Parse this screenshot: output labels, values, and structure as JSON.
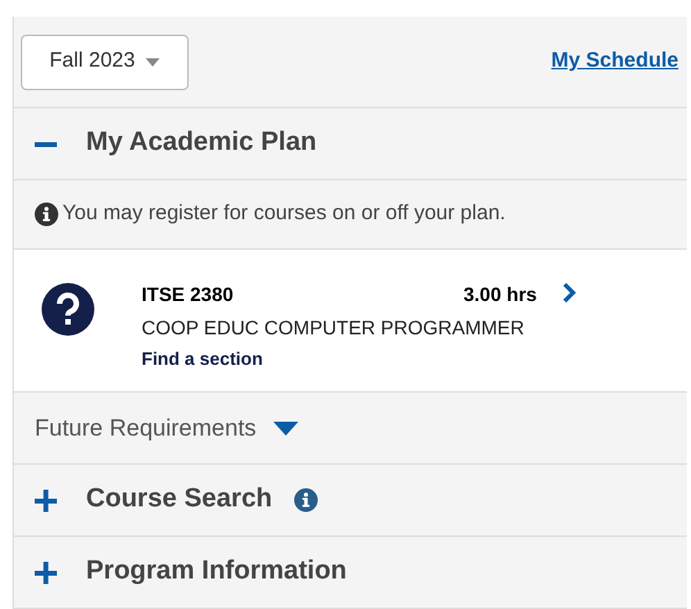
{
  "term_select": {
    "value": "Fall 2023"
  },
  "schedule_link": "My Schedule",
  "academic_plan": {
    "title": "My Academic Plan",
    "expanded": true,
    "notice": "You may register for courses on or off your plan.",
    "courses": [
      {
        "code": "ITSE 2380",
        "hours": "3.00 hrs",
        "title": "COOP EDUC COMPUTER PROGRAMMER",
        "action": "Find a section"
      }
    ],
    "future_requirements": {
      "label": "Future Requirements",
      "expanded": false
    }
  },
  "sections": [
    {
      "title": "Course Search",
      "expanded": false,
      "info": true
    },
    {
      "title": "Program Information",
      "expanded": false,
      "info": false
    }
  ]
}
